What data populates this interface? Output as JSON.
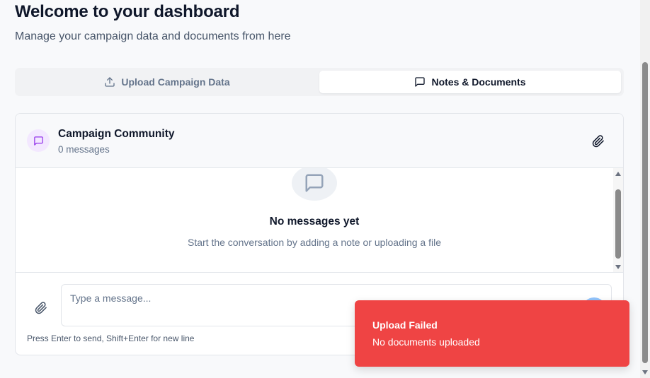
{
  "header": {
    "title": "Welcome to your dashboard",
    "subtitle": "Manage your campaign data and documents from here"
  },
  "tabs": [
    {
      "label": "Upload Campaign Data",
      "icon": "upload-icon",
      "active": false
    },
    {
      "label": "Notes & Documents",
      "icon": "message-square-icon",
      "active": true
    }
  ],
  "chat": {
    "name": "Campaign Community",
    "message_count": "0 messages",
    "empty_title": "No messages yet",
    "empty_description": "Start the conversation by adding a note or uploading a file",
    "input_placeholder": "Type a message...",
    "hint": "Press Enter to send, Shift+Enter for new line"
  },
  "toast": {
    "title": "Upload Failed",
    "description": "No documents uploaded",
    "color": "#ef4444"
  },
  "colors": {
    "accent_purple": "#9333ea",
    "avatar_bg": "#f3e8ff"
  }
}
